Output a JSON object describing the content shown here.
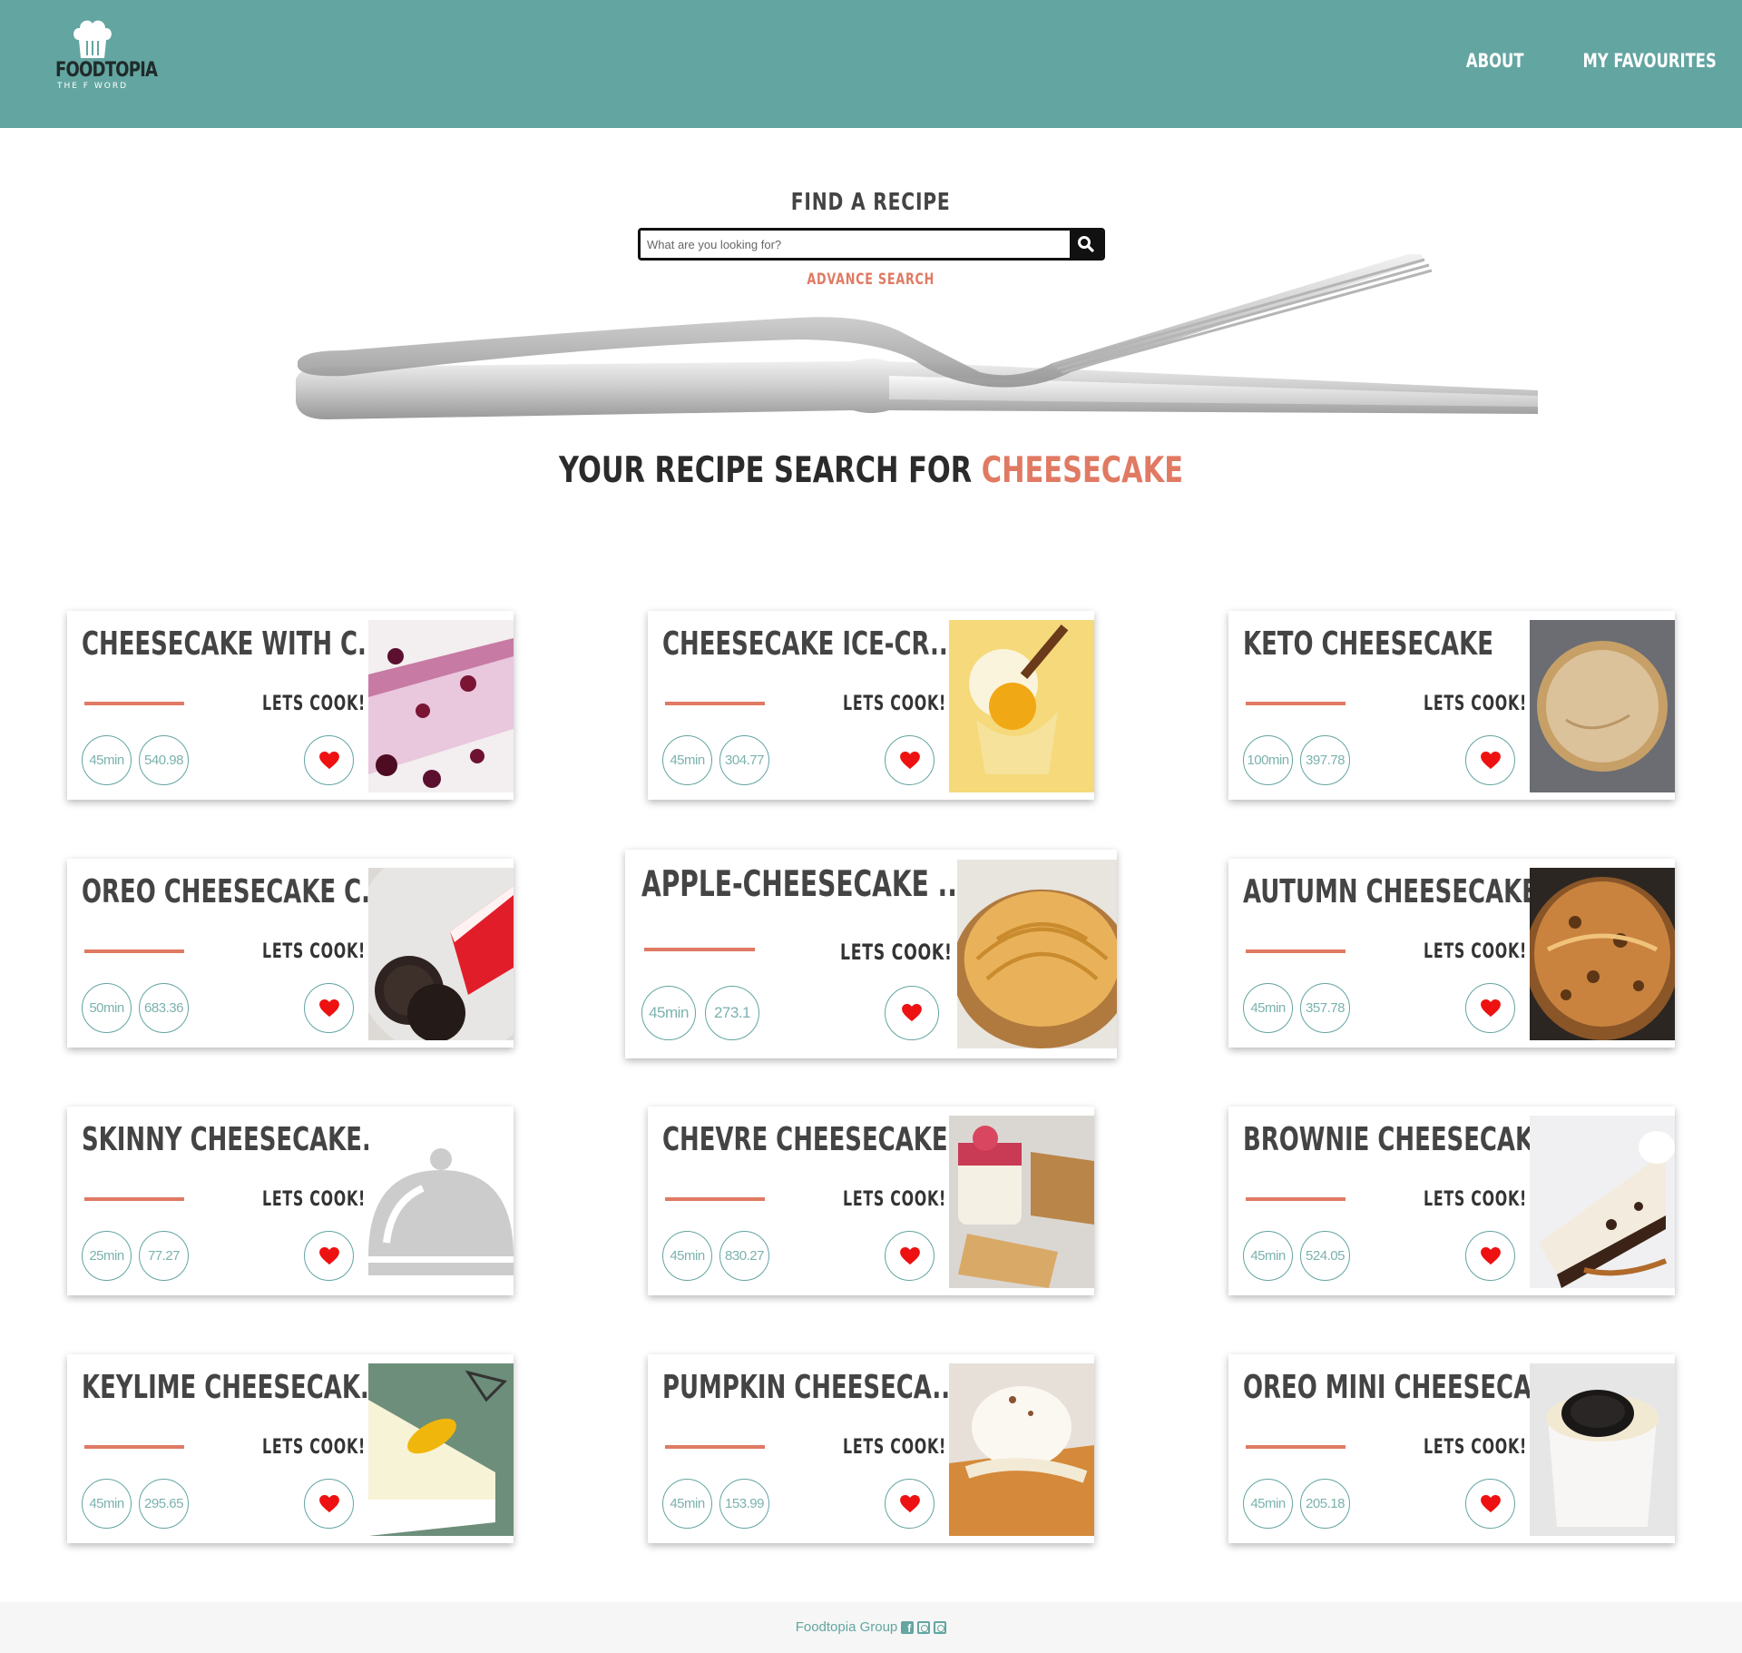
{
  "header": {
    "brand": "FOODTOPIA",
    "tagline": "THE F WORD",
    "nav": [
      "ABOUT",
      "MY FAVOURITES"
    ],
    "bg_color": "#63a5a1"
  },
  "search": {
    "title": "FIND A RECIPE",
    "placeholder": "What are you looking for?",
    "value": "",
    "advance_label": "ADVANCE SEARCH"
  },
  "results": {
    "prefix": "YOUR RECIPE SEARCH FOR",
    "term": "CHEESECAKE",
    "accent_color": "#e07a63"
  },
  "cards": [
    {
      "title": "CHEESECAKE WITH C...",
      "cta": "LETS COOK!",
      "time": "45min",
      "calories": "540.98",
      "image": "berry-cheesecake-slice"
    },
    {
      "title": "CHEESECAKE ICE-CR...",
      "cta": "LETS COOK!",
      "time": "45min",
      "calories": "304.77",
      "image": "ice-cream-glass"
    },
    {
      "title": "KETO CHEESECAKE",
      "cta": "LETS COOK!",
      "time": "100min",
      "calories": "397.78",
      "image": "whole-keto-cheesecake"
    },
    {
      "title": "OREO CHEESECAKE C...",
      "cta": "LETS COOK!",
      "time": "50min",
      "calories": "683.36",
      "image": "oreo-cookies-red-cake"
    },
    {
      "title": "APPLE-CHEESECAKE ...",
      "cta": "LETS COOK!",
      "time": "45min",
      "calories": "273.1",
      "image": "apple-tart"
    },
    {
      "title": "AUTUMN CHEESECAKE",
      "cta": "LETS COOK!",
      "time": "45min",
      "calories": "357.78",
      "image": "autumn-nut-cake"
    },
    {
      "title": "SKINNY CHEESECAKE...",
      "cta": "LETS COOK!",
      "time": "25min",
      "calories": "77.27",
      "image": "placeholder-cloche"
    },
    {
      "title": "CHEVRE CHEESECAKE...",
      "cta": "LETS COOK!",
      "time": "45min",
      "calories": "830.27",
      "image": "chevre-jar-dessert"
    },
    {
      "title": "BROWNIE CHEESECAKE",
      "cta": "LETS COOK!",
      "time": "45min",
      "calories": "524.05",
      "image": "brownie-cheesecake-slice"
    },
    {
      "title": "KEYLIME CHEESECAK...",
      "cta": "LETS COOK!",
      "time": "45min",
      "calories": "295.65",
      "image": "keylime-slice"
    },
    {
      "title": "PUMPKIN CHEESECA...",
      "cta": "LETS COOK!",
      "time": "45min",
      "calories": "153.99",
      "image": "pumpkin-slice-cream"
    },
    {
      "title": "OREO MINI CHEESECA...",
      "cta": "LETS COOK!",
      "time": "45min",
      "calories": "205.18",
      "image": "oreo-mini-cup"
    }
  ],
  "footer": {
    "text": "Foodtopia Group",
    "icons": [
      "facebook-icon",
      "instagram-icon",
      "instagram-icon"
    ]
  }
}
